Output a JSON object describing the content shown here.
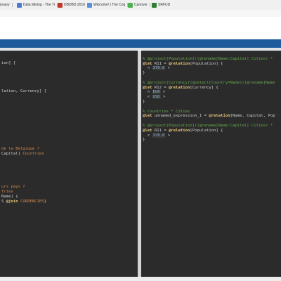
{
  "bookmarks": [
    {
      "label": "ionary",
      "icon": "bookmark-icon",
      "color": "#777777"
    },
    {
      "label": "Data Mining - The Tr",
      "icon": "page-icon",
      "color": "#4a7bd0"
    },
    {
      "label": "DBDBD 2016",
      "icon": "page-icon",
      "color": "#c0392b"
    },
    {
      "label": "Welcome! | The Coq",
      "icon": "page-icon",
      "color": "#5b8fd6"
    },
    {
      "label": "Canover",
      "icon": "page-icon",
      "color": "#4caf50"
    },
    {
      "label": "SRFUD",
      "icon": "page-icon",
      "color": "#2e7d32"
    }
  ],
  "left_code": [
    "",
    "",
    "ion] {",
    "",
    "",
    "",
    "",
    "",
    "lation, Currency] {",
    "",
    "",
    "",
    "",
    "",
    "",
    "",
    "",
    "",
    "",
    "",
    "de la Belgique ?",
    "Capital] Countries",
    "",
    "",
    "",
    "",
    "",
    "",
    "urs pays ?",
    "tries",
    "Name] {",
    "S @join CURRENCIES}"
  ],
  "right": {
    "block1": {
      "comment": "% @project[Population]((@rename[Name:Capital] Cities) *",
      "let_kw": "@let",
      "let_rest": " R11 = ",
      "rel_kw": "@relation",
      "rel_rest": "[Population] {",
      "values": [
        "370.0"
      ],
      "close": "}"
    },
    "block2": {
      "comment": "% @project[Currency](@select[Country=Name]((@rename[Name",
      "let_kw": "@let",
      "let_rest": " R12 = ",
      "rel_kw": "@relation",
      "rel_rest": "[Currency] {",
      "values": [
        "EUR",
        "USD"
      ],
      "close": "}"
    },
    "block3": {
      "comment": "% Countries * Cities",
      "let_kw": "@let",
      "let_rest": " unnamed_expression_1 = ",
      "rel_kw": "@relation",
      "rel_rest": "[Name, Capital, Pop"
    },
    "block4": {
      "comment": "% @project[Population]((@rename[Name:Capital] Cities) *",
      "let_kw": "@let",
      "let_rest": " R11 = ",
      "rel_kw": "@relation",
      "rel_rest": "[Population] {",
      "values": [
        "370.0"
      ],
      "close": "}"
    }
  },
  "colors": {
    "app_bar": "#1e5b9c",
    "editor_bg": "#2b2b2b",
    "comment": "#6aa84f",
    "keyword": "#e8c87a"
  }
}
